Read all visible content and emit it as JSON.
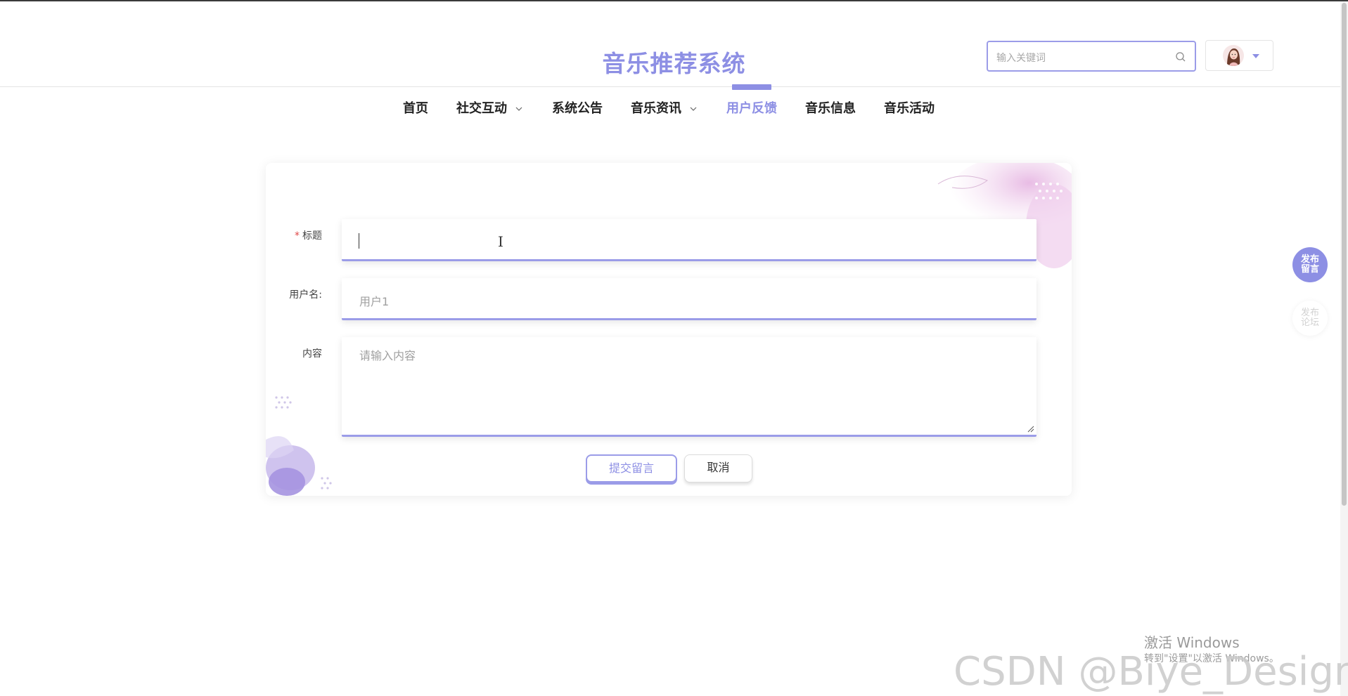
{
  "header": {
    "site_title": "音乐推荐系统",
    "search_placeholder": "输入关键词"
  },
  "nav": {
    "items": [
      {
        "label": "首页",
        "has_dropdown": false,
        "active": false
      },
      {
        "label": "社交互动",
        "has_dropdown": true,
        "active": false
      },
      {
        "label": "系统公告",
        "has_dropdown": false,
        "active": false
      },
      {
        "label": "音乐资讯",
        "has_dropdown": true,
        "active": false
      },
      {
        "label": "用户反馈",
        "has_dropdown": false,
        "active": true
      },
      {
        "label": "音乐信息",
        "has_dropdown": false,
        "active": false
      },
      {
        "label": "音乐活动",
        "has_dropdown": false,
        "active": false
      }
    ]
  },
  "form": {
    "required_mark": "*",
    "title_label": "标题",
    "title_value": "",
    "username_label": "用户名:",
    "username_value": "用户1",
    "content_label": "内容",
    "content_placeholder": "请输入内容",
    "submit_label": "提交留言",
    "cancel_label": "取消"
  },
  "floating": {
    "post_message": "发布留言",
    "post_forum": "发布论坛"
  },
  "overlay": {
    "activate_windows": "激活 Windows",
    "activate_hint": "转到\"设置\"以激活 Windows。",
    "watermark": "CSDN @Biye_Design"
  },
  "colors": {
    "accent": "#8d8fe4",
    "required": "#e04848"
  },
  "icons": {
    "search": "search-icon",
    "avatar": "avatar",
    "dropdown": "caret-down-icon",
    "chevron": "chevron-down-icon"
  }
}
